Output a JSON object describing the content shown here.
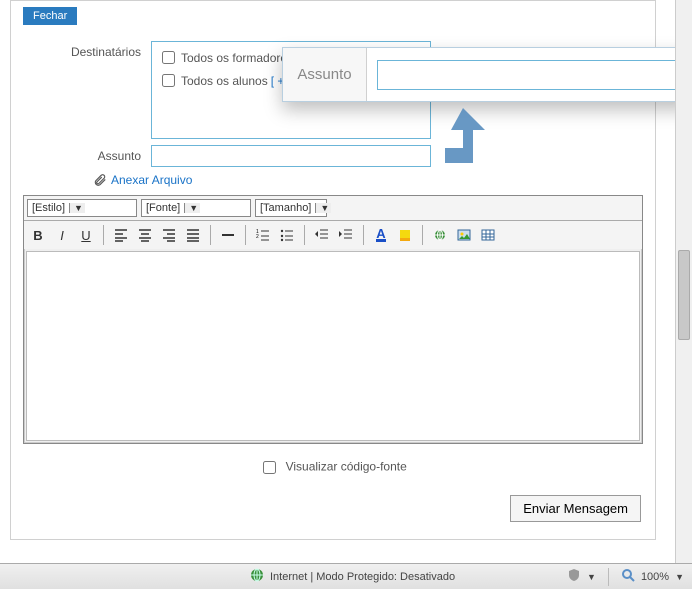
{
  "buttons": {
    "close": "Fechar",
    "send": "Enviar Mensagem"
  },
  "labels": {
    "recipients": "Destinatários",
    "subject": "Assunto",
    "view_source": "Visualizar código-fonte"
  },
  "recipients": {
    "trainers": "Todos os formadores",
    "trainers_extra": "[",
    "students": "Todos os alunos",
    "students_plus": "[ + ]"
  },
  "attach": {
    "label": "Anexar Arquivo"
  },
  "editor": {
    "style": "[Estilo]",
    "font": "[Fonte]",
    "size": "[Tamanho]"
  },
  "callout": {
    "subject": "Assunto"
  },
  "statusbar": {
    "mode": "Internet | Modo Protegido: Desativado",
    "zoom": "100%"
  }
}
